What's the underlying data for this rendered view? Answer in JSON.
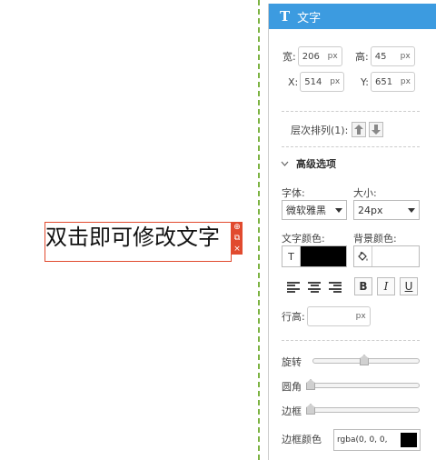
{
  "canvas": {
    "text_box": {
      "content": "双击即可修改文字"
    },
    "handles": {
      "move": "⊕",
      "copy": "⧉",
      "close": "×"
    }
  },
  "panel": {
    "header": {
      "icon": "T",
      "title": "文字"
    },
    "size": {
      "width_label": "宽:",
      "width_value": "206",
      "width_unit": "px",
      "height_label": "高:",
      "height_value": "45",
      "height_unit": "px"
    },
    "position": {
      "x_label": "X:",
      "x_value": "514",
      "x_unit": "px",
      "y_label": "Y:",
      "y_value": "651",
      "y_unit": "px"
    },
    "layer": {
      "label": "层次排列(1):"
    },
    "advanced": {
      "label": "高级选项"
    },
    "font": {
      "label": "字体:",
      "value": "微软雅黑"
    },
    "font_size": {
      "label": "大小:",
      "value": "24px"
    },
    "text_color": {
      "label": "文字颜色:",
      "icon": "T",
      "color": "#000000"
    },
    "bg_color": {
      "label": "背景颜色:",
      "color": "#ffffff"
    },
    "format": {
      "bold": "B",
      "italic": "I",
      "underline": "U"
    },
    "line_height": {
      "label": "行高:",
      "unit": "px",
      "value": ""
    },
    "rotate": {
      "label": "旋转",
      "level": 0.5
    },
    "radius": {
      "label": "圆角",
      "level": 0
    },
    "border": {
      "label": "边框",
      "level": 0
    },
    "border_color": {
      "label": "边框颜色",
      "value": "rgba(0, 0, 0,",
      "color": "#000000"
    }
  }
}
